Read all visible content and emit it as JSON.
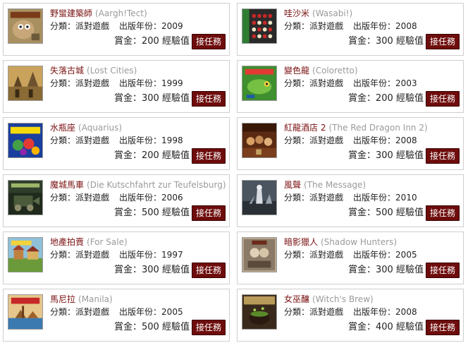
{
  "quests": [
    {
      "title_zh": "野蠻建築師",
      "title_en": "(Aargh!Tect)",
      "category_label": "分類：",
      "category": "派對遊戲",
      "year_label": "出版年份：",
      "year": "2009",
      "reward_label": "賞金：",
      "reward_value": "200",
      "reward_unit": "經驗值",
      "button": "接任務",
      "cover_icon": "aargh-tect-cover-icon"
    },
    {
      "title_zh": "哇沙米",
      "title_en": "(Wasabi!)",
      "category_label": "分類：",
      "category": "派對遊戲",
      "year_label": "出版年份：",
      "year": "2008",
      "reward_label": "賞金：",
      "reward_value": "300",
      "reward_unit": "經驗值",
      "button": "接任務",
      "cover_icon": "wasabi-cover-icon"
    },
    {
      "title_zh": "失落古城",
      "title_en": "(Lost Cities)",
      "category_label": "分類：",
      "category": "派對遊戲",
      "year_label": "出版年份：",
      "year": "1999",
      "reward_label": "賞金：",
      "reward_value": "300",
      "reward_unit": "經驗值",
      "button": "接任務",
      "cover_icon": "lost-cities-cover-icon"
    },
    {
      "title_zh": "變色龍",
      "title_en": "(Coloretto)",
      "category_label": "分類：",
      "category": "派對遊戲",
      "year_label": "出版年份：",
      "year": "2003",
      "reward_label": "賞金：",
      "reward_value": "200",
      "reward_unit": "經驗值",
      "button": "接任務",
      "cover_icon": "coloretto-cover-icon"
    },
    {
      "title_zh": "水瓶座",
      "title_en": "(Aquarius)",
      "category_label": "分類：",
      "category": "派對遊戲",
      "year_label": "出版年份：",
      "year": "1998",
      "reward_label": "賞金：",
      "reward_value": "200",
      "reward_unit": "經驗值",
      "button": "接任務",
      "cover_icon": "aquarius-cover-icon"
    },
    {
      "title_zh": "紅龍酒店 2",
      "title_en": "(The Red Dragon Inn 2)",
      "category_label": "分類：",
      "category": "派對遊戲",
      "year_label": "出版年份：",
      "year": "2008",
      "reward_label": "賞金：",
      "reward_value": "300",
      "reward_unit": "經驗值",
      "button": "接任務",
      "cover_icon": "red-dragon-inn-cover-icon"
    },
    {
      "title_zh": "魔城馬車",
      "title_en": "(Die Kutschfahrt zur Teufelsburg)",
      "category_label": "分類：",
      "category": "派對遊戲",
      "year_label": "出版年份：",
      "year": "2006",
      "reward_label": "賞金：",
      "reward_value": "500",
      "reward_unit": "經驗值",
      "button": "接任務",
      "cover_icon": "kutschfahrt-cover-icon"
    },
    {
      "title_zh": "風聲",
      "title_en": "(The Message)",
      "category_label": "分類：",
      "category": "派對遊戲",
      "year_label": "出版年份：",
      "year": "2010",
      "reward_label": "賞金：",
      "reward_value": "500",
      "reward_unit": "經驗值",
      "button": "接任務",
      "cover_icon": "the-message-cover-icon"
    },
    {
      "title_zh": "地產拍賣",
      "title_en": "(For Sale)",
      "category_label": "分類：",
      "category": "派對遊戲",
      "year_label": "出版年份：",
      "year": "1997",
      "reward_label": "賞金：",
      "reward_value": "300",
      "reward_unit": "經驗值",
      "button": "接任務",
      "cover_icon": "for-sale-cover-icon"
    },
    {
      "title_zh": "暗影獵人",
      "title_en": "(Shadow Hunters)",
      "category_label": "分類：",
      "category": "派對遊戲",
      "year_label": "出版年份：",
      "year": "2005",
      "reward_label": "賞金：",
      "reward_value": "300",
      "reward_unit": "經驗值",
      "button": "接任務",
      "cover_icon": "shadow-hunters-cover-icon"
    },
    {
      "title_zh": "馬尼拉",
      "title_en": "(Manila)",
      "category_label": "分類：",
      "category": "派對遊戲",
      "year_label": "出版年份：",
      "year": "2005",
      "reward_label": "賞金：",
      "reward_value": "500",
      "reward_unit": "經驗值",
      "button": "接任務",
      "cover_icon": "manila-cover-icon"
    },
    {
      "title_zh": "女巫釀",
      "title_en": "(Witch's Brew)",
      "category_label": "分類：",
      "category": "派對遊戲",
      "year_label": "出版年份：",
      "year": "2008",
      "reward_label": "賞金：",
      "reward_value": "400",
      "reward_unit": "經驗值",
      "button": "接任務",
      "cover_icon": "witchs-brew-cover-icon"
    }
  ],
  "colors": {
    "title": "#7a1010",
    "subtitle": "#9a9a9a",
    "button_bg": "#6e0c0c",
    "button_text": "#ffffff",
    "card_border": "#cfcfcf"
  }
}
